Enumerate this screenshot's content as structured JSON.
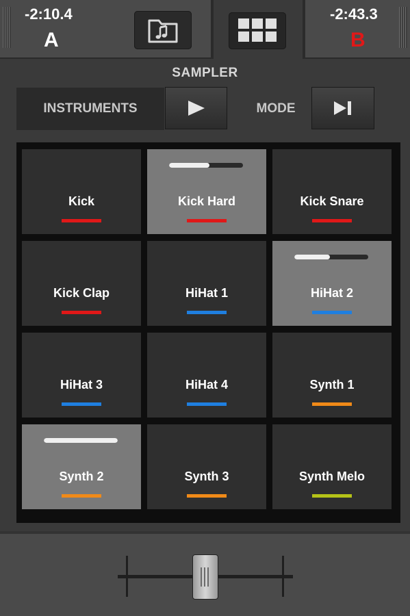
{
  "deck_a": {
    "time": "-2:10.4",
    "letter": "A",
    "letter_color": "#ffffff"
  },
  "deck_b": {
    "time": "-2:43.3",
    "letter": "B",
    "letter_color": "#e01818"
  },
  "toolbar": {
    "folder_icon": "music-folder-icon",
    "grid_icon": "grid-view-icon"
  },
  "sampler": {
    "title": "SAMPLER",
    "instruments_label": "INSTRUMENTS",
    "play_icon": "play-icon",
    "mode_label": "MODE",
    "mode_icon": "skip-next-icon"
  },
  "pads": [
    {
      "label": "Kick",
      "color": "#e01818",
      "active": false
    },
    {
      "label": "Kick Hard",
      "color": "#e01818",
      "active": true,
      "progress": 0.55
    },
    {
      "label": "Kick Snare",
      "color": "#e01818",
      "active": false
    },
    {
      "label": "Kick Clap",
      "color": "#e01818",
      "active": false
    },
    {
      "label": "HiHat 1",
      "color": "#1f7fe0",
      "active": false
    },
    {
      "label": "HiHat 2",
      "color": "#1f7fe0",
      "active": true,
      "progress": 0.48
    },
    {
      "label": "HiHat 3",
      "color": "#1f7fe0",
      "active": false
    },
    {
      "label": "HiHat 4",
      "color": "#1f7fe0",
      "active": false
    },
    {
      "label": "Synth 1",
      "color": "#f08a18",
      "active": false
    },
    {
      "label": "Synth 2",
      "color": "#f08a18",
      "active": true,
      "progress": 1.0
    },
    {
      "label": "Synth 3",
      "color": "#f08a18",
      "active": false
    },
    {
      "label": "Synth Melo",
      "color": "#b5c218",
      "active": false
    }
  ],
  "crossfader": {
    "position": 0.5
  }
}
